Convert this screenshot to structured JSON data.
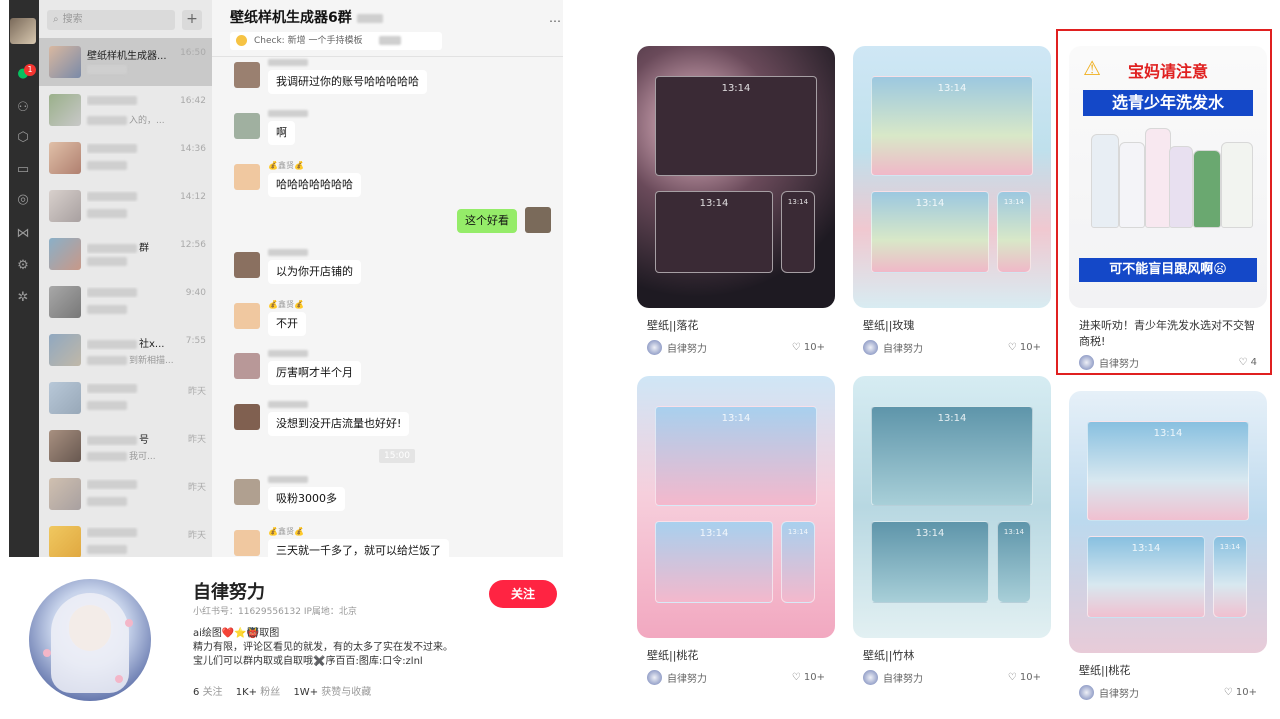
{
  "wechat": {
    "search_placeholder": "搜索",
    "plus_label": "+",
    "chat_title": "壁纸样机生成器6群",
    "notice": "Check: 新增 一个手持模板",
    "unread_badge": "1",
    "timestamp_chip": "15:00",
    "conversations": [
      {
        "name": "壁纸样机生成器...",
        "time": "16:50"
      },
      {
        "name": "",
        "time": "16:42",
        "preview": "入的，..."
      },
      {
        "name": "",
        "time": "14:36"
      },
      {
        "name": "",
        "time": "14:12"
      },
      {
        "name": "群",
        "time": "12:56"
      },
      {
        "name": "",
        "time": "9:40"
      },
      {
        "name": "社x...",
        "time": "7:55",
        "preview": "到新相描..."
      },
      {
        "name": "",
        "time": "昨天"
      },
      {
        "name": "号",
        "time": "昨天",
        "preview": "我可..."
      },
      {
        "name": "",
        "time": "昨天"
      },
      {
        "name": "",
        "time": "昨天"
      }
    ],
    "messages": [
      {
        "text": "我调研过你的账号哈哈哈哈哈"
      },
      {
        "text": "啊"
      },
      {
        "sender": "💰鑫贤💰",
        "text": "哈哈哈哈哈哈哈"
      },
      {
        "text": "这个好看",
        "mine": true
      },
      {
        "text": "以为你开店铺的"
      },
      {
        "sender": "💰鑫贤💰",
        "text": "不开"
      },
      {
        "text": "厉害啊才半个月"
      },
      {
        "text": "没想到没开店流量也好好!"
      },
      {
        "text": "吸粉3000多"
      },
      {
        "sender": "💰鑫贤💰",
        "text": "三天就一千多了，就可以给烂饭了"
      }
    ]
  },
  "profile": {
    "name": "自律努力",
    "id_line": "小红书号：11629556132    IP属地：北京",
    "desc_line1": "ai绘图❤️⭐👹取图",
    "desc_line2": "精力有限，评论区看见的就发，有的太多了实在发不过来。",
    "desc_line3": "宝儿们可以群内取或自取哦✖️序百百:图库:口令:zlnl",
    "follow_label": "关注",
    "following_count": "6",
    "following_label": "关注",
    "fans_count": "1K+",
    "fans_label": "粉丝",
    "likes_count": "1W+",
    "likes_label": "获赞与收藏"
  },
  "feed": {
    "clock_text": "13:14",
    "cards": [
      {
        "title": "壁纸||落花",
        "author": "自律努力",
        "likes": "10+",
        "theme": "dark-sakura"
      },
      {
        "title": "壁纸||玫瑰",
        "author": "自律努力",
        "likes": "10+",
        "theme": "rose-field"
      },
      {
        "title": "进来听劝！青少年洗发水选对不交智商税!",
        "author": "自律努力",
        "likes": "4",
        "theme": "shampoo-ad"
      },
      {
        "title": "壁纸||桃花",
        "author": "自律努力",
        "likes": "10+",
        "theme": "peach-blossom"
      },
      {
        "title": "壁纸||竹林",
        "author": "自律努力",
        "likes": "10+",
        "theme": "bamboo"
      },
      {
        "title": "壁纸||桃花",
        "author": "自律努力",
        "likes": "10+",
        "theme": "peach-lake"
      }
    ],
    "ad": {
      "headline": "宝妈请注意",
      "subheadline": "选青少年洗发水",
      "footer": "可不能盲目跟风啊😦"
    }
  },
  "colors": {
    "wechat_green": "#07c160",
    "bubble_green": "#95ec69",
    "follow_red": "#ff2442",
    "highlight_red": "#e02020"
  }
}
